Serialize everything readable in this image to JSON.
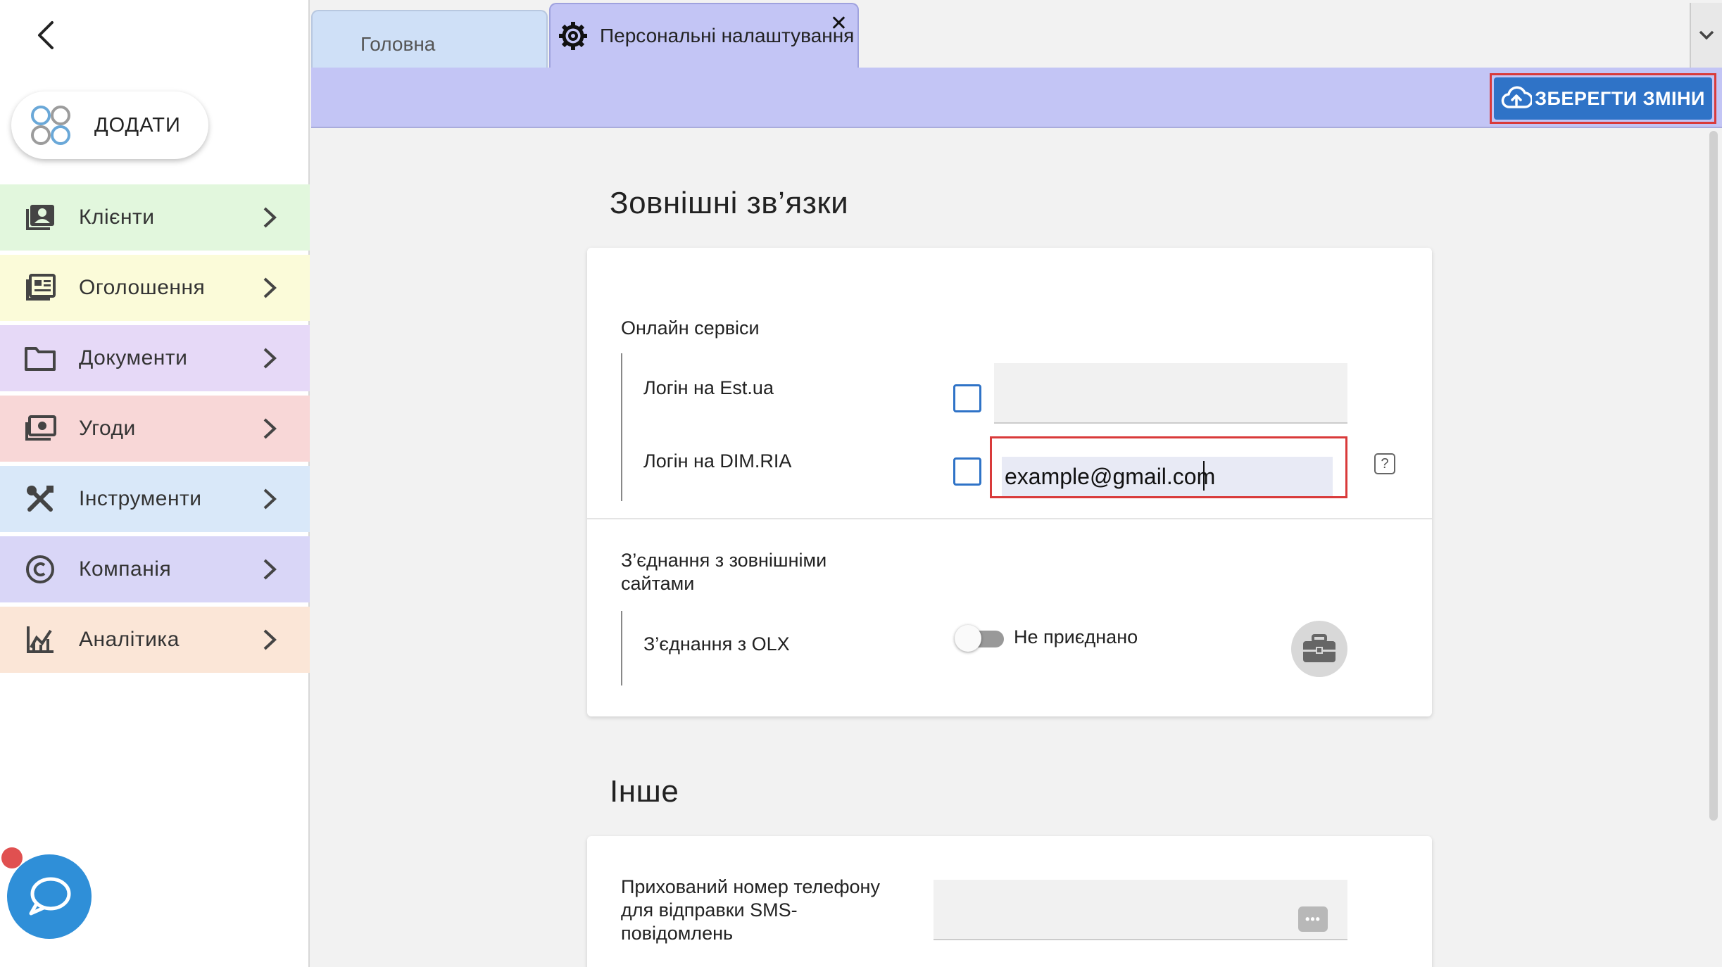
{
  "sidebar": {
    "add_label": "ДОДАТИ",
    "items": [
      {
        "label": "Клієнти",
        "color": "#e2f7dd",
        "icon": "contacts-icon"
      },
      {
        "label": "Оголошення",
        "color": "#fbfbd9",
        "icon": "listings-icon"
      },
      {
        "label": "Документи",
        "color": "#e6d9f7",
        "icon": "folder-icon"
      },
      {
        "label": "Угоди",
        "color": "#f8d7d7",
        "icon": "money-icon"
      },
      {
        "label": "Інструменти",
        "color": "#d9e8f9",
        "icon": "tools-icon"
      },
      {
        "label": "Компанія",
        "color": "#d9d6f7",
        "icon": "copyright-icon"
      },
      {
        "label": "Аналітика",
        "color": "#fbe6d7",
        "icon": "analytics-icon"
      }
    ]
  },
  "tabs": {
    "home_label": "Головна",
    "settings_label": "Персональні налаштування",
    "close_symbol": "✕"
  },
  "toolbar": {
    "save_label": "ЗБЕРЕГТИ ЗМІНИ"
  },
  "external": {
    "title": "Зовнішні зв’язки",
    "online_services_title": "Онлайн сервіси",
    "est_label": "Логін на Est.ua",
    "est_value": "",
    "dimria_label": "Логін на DIM.RIA",
    "dimria_value": "example@gmail.com",
    "help_symbol": "?",
    "connections_title": "З’єднання з зовнішніми сайтами",
    "olx_label": "З’єднання з OLX",
    "olx_status": "Не приєднано"
  },
  "other": {
    "title": "Інше",
    "sms_label": "Прихований номер телефону для відправки SMS-повідомлень",
    "sms_icon_text": "•••"
  }
}
